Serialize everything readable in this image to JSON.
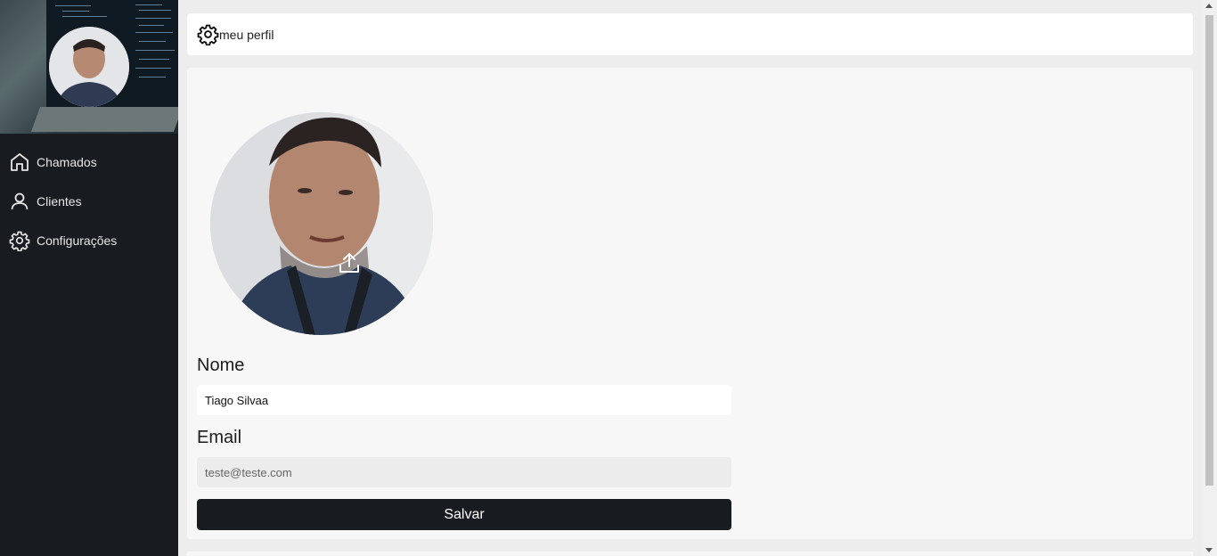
{
  "sidebar": {
    "items": [
      {
        "label": "Chamados",
        "icon": "home-icon"
      },
      {
        "label": "Clientes",
        "icon": "user-icon"
      },
      {
        "label": "Configurações",
        "icon": "gear-icon"
      }
    ]
  },
  "header": {
    "title": "meu perfil",
    "icon": "gear-icon"
  },
  "profile": {
    "name_label": "Nome",
    "name_value": "Tiago Silvaa",
    "email_label": "Email",
    "email_value": "teste@teste.com",
    "save_label": "Salvar",
    "upload_icon": "upload-icon"
  },
  "colors": {
    "sidebar_bg": "#181c21",
    "button_bg": "#181c21",
    "content_bg": "#f7f7f7"
  }
}
